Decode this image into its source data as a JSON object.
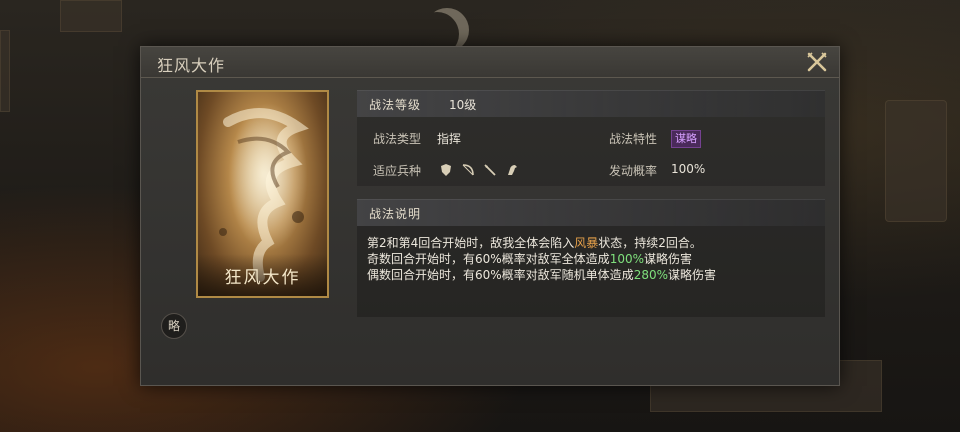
{
  "dialog": {
    "title": "狂风大作",
    "card_name": "狂风大作",
    "badge": "略"
  },
  "info": {
    "level_label": "战法等级",
    "level_value": "10级",
    "type_label": "战法类型",
    "type_value": "指挥",
    "trait_label": "战法特性",
    "trait_value": "谋略",
    "units_label": "适应兵种",
    "units": [
      "shield-icon",
      "bow-icon",
      "spear-icon",
      "horse-icon"
    ],
    "chance_label": "发动概率",
    "chance_value": "100%"
  },
  "description": {
    "header": "战法说明",
    "line1_pre": "第2和第4回合开始时，敌我全体会陷入",
    "line1_hl": "风暴",
    "line1_post": "状态，持续2回合。",
    "line2_pre": "奇数回合开始时，有60%概率对敌军全体造成",
    "line2_hl": "100%",
    "line2_post": "谋略伤害",
    "line3_pre": "偶数回合开始时，有60%概率对敌军随机单体造成",
    "line3_hl": "280%",
    "line3_post": "谋略伤害"
  },
  "colors": {
    "highlight_orange": "#e6a04a",
    "highlight_green": "#7fe07c",
    "trait_purple": "#d7a0ff"
  }
}
